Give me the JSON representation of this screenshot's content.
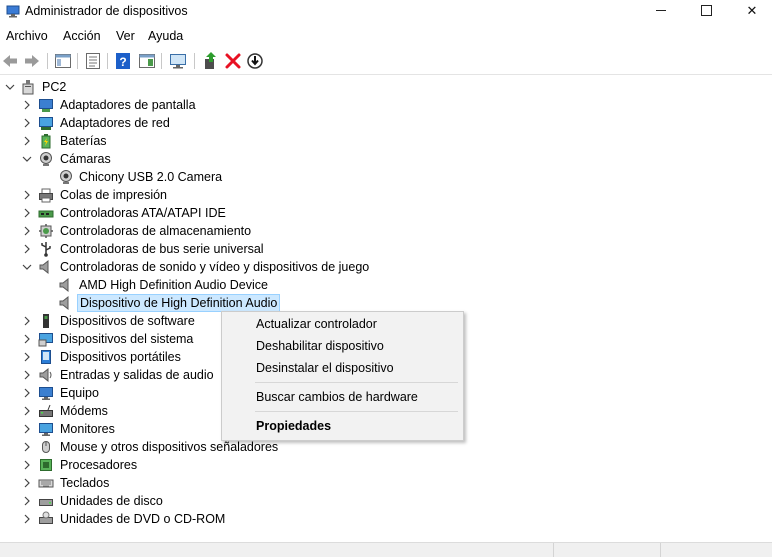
{
  "window": {
    "title": "Administrador de dispositivos",
    "controls": {
      "minimize": "minimize",
      "maximize": "maximize",
      "close": "✕"
    }
  },
  "menu": [
    "Archivo",
    "Acción",
    "Ver",
    "Ayuda"
  ],
  "toolbar": [
    "back-arrow-icon",
    "forward-arrow-icon",
    "show-hide-console-tree-icon",
    "properties-icon",
    "help-icon",
    "action-pane-icon",
    "scan-hardware-icon",
    "update-driver-icon",
    "uninstall-device-icon",
    "disable-device-icon"
  ],
  "tree": {
    "root": "PC2",
    "categories": [
      {
        "label": "Adaptadores de pantalla",
        "icon": "display-adapter-icon",
        "expanded": false
      },
      {
        "label": "Adaptadores de red",
        "icon": "network-adapter-icon",
        "expanded": false
      },
      {
        "label": "Baterías",
        "icon": "battery-icon",
        "expanded": false
      },
      {
        "label": "Cámaras",
        "icon": "camera-icon",
        "expanded": true,
        "children": [
          "Chicony USB 2.0 Camera"
        ]
      },
      {
        "label": "Colas de impresión",
        "icon": "printer-icon",
        "expanded": false
      },
      {
        "label": "Controladoras ATA/ATAPI IDE",
        "icon": "ide-controller-icon",
        "expanded": false
      },
      {
        "label": "Controladoras de almacenamiento",
        "icon": "storage-controller-icon",
        "expanded": false
      },
      {
        "label": "Controladoras de bus serie universal",
        "icon": "usb-icon",
        "expanded": false
      },
      {
        "label": "Controladoras de sonido y vídeo y dispositivos de juego",
        "icon": "speaker-icon",
        "expanded": true,
        "children": [
          "AMD High Definition Audio Device",
          "Dispositivo de High Definition Audio"
        ]
      },
      {
        "label": "Dispositivos de software",
        "icon": "software-device-icon",
        "expanded": false
      },
      {
        "label": "Dispositivos del sistema",
        "icon": "system-device-icon",
        "expanded": false
      },
      {
        "label": "Dispositivos portátiles",
        "icon": "portable-device-icon",
        "expanded": false
      },
      {
        "label": "Entradas y salidas de audio",
        "icon": "audio-io-icon",
        "expanded": false
      },
      {
        "label": "Equipo",
        "icon": "computer-icon",
        "expanded": false
      },
      {
        "label": "Módems",
        "icon": "modem-icon",
        "expanded": false
      },
      {
        "label": "Monitores",
        "icon": "monitor-icon",
        "expanded": false
      },
      {
        "label": "Mouse y otros dispositivos señaladores",
        "icon": "mouse-icon",
        "expanded": false
      },
      {
        "label": "Procesadores",
        "icon": "processor-icon",
        "expanded": false
      },
      {
        "label": "Teclados",
        "icon": "keyboard-icon",
        "expanded": false
      },
      {
        "label": "Unidades de disco",
        "icon": "disk-drive-icon",
        "expanded": false
      },
      {
        "label": "Unidades de DVD o CD-ROM",
        "icon": "dvd-drive-icon",
        "expanded": false
      }
    ],
    "selected": "Dispositivo de High Definition Audio"
  },
  "context_menu": {
    "items": [
      {
        "label": "Actualizar controlador",
        "bold": false
      },
      {
        "label": "Deshabilitar dispositivo",
        "bold": false
      },
      {
        "label": "Desinstalar el dispositivo",
        "bold": false
      },
      {
        "separator": true
      },
      {
        "label": "Buscar cambios de hardware",
        "bold": false
      },
      {
        "separator": true
      },
      {
        "label": "Propiedades",
        "bold": true
      }
    ]
  },
  "colors": {
    "selection_bg": "#cce8ff",
    "selection_border": "#99d1ff",
    "menu_bg": "#f2f2f2",
    "uninstall_red": "#e81123",
    "help_blue": "#1c5fc9"
  }
}
